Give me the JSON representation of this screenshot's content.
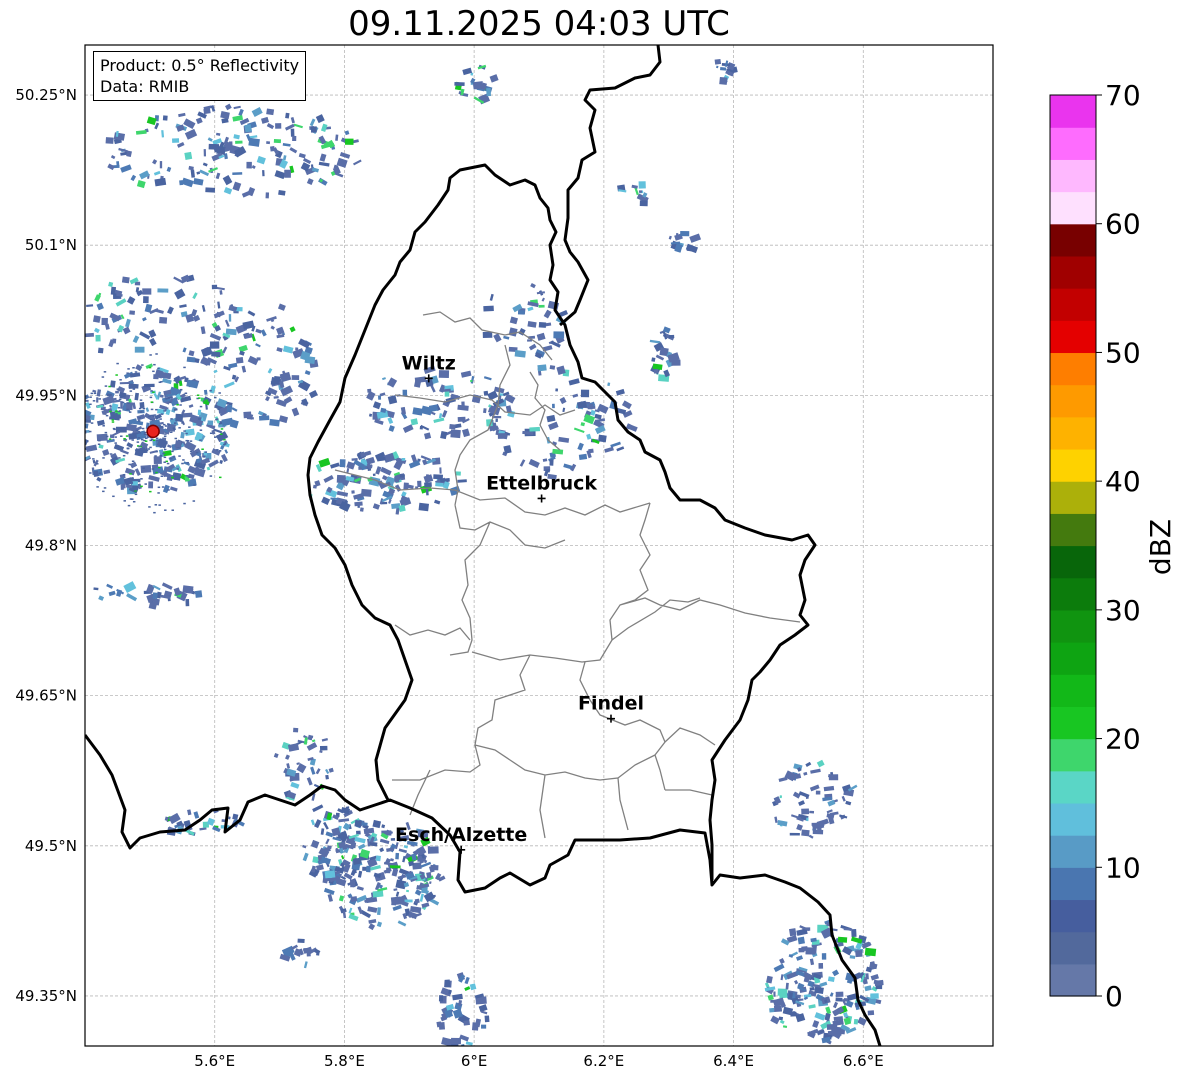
{
  "title": "09.11.2025 04:03 UTC",
  "info_box": {
    "product": "Product: 0.5° Reflectivity",
    "data": "Data: RMIB"
  },
  "map": {
    "lon_range": [
      5.4,
      6.8
    ],
    "lat_range": [
      49.3,
      50.3
    ],
    "lat_ticks": [
      {
        "value": 50.25,
        "label": "50.25°N"
      },
      {
        "value": 50.1,
        "label": "50.1°N"
      },
      {
        "value": 49.95,
        "label": "49.95°N"
      },
      {
        "value": 49.8,
        "label": "49.8°N"
      },
      {
        "value": 49.65,
        "label": "49.65°N"
      },
      {
        "value": 49.5,
        "label": "49.5°N"
      },
      {
        "value": 49.35,
        "label": "49.35°N"
      }
    ],
    "lon_ticks": [
      {
        "value": 5.6,
        "label": "5.6°E"
      },
      {
        "value": 5.8,
        "label": "5.8°E"
      },
      {
        "value": 6.0,
        "label": "6°E"
      },
      {
        "value": 6.2,
        "label": "6.2°E"
      },
      {
        "value": 6.4,
        "label": "6.4°E"
      },
      {
        "value": 6.6,
        "label": "6.6°E"
      }
    ],
    "cities": [
      {
        "name": "Wiltz",
        "lon": 5.93,
        "lat": 49.967
      },
      {
        "name": "Ettelbruck",
        "lon": 6.104,
        "lat": 49.847
      },
      {
        "name": "Findel",
        "lon": 6.211,
        "lat": 49.627
      },
      {
        "name": "Esch/Alzette",
        "lon": 5.98,
        "lat": 49.496
      }
    ],
    "radar_site": {
      "lon": 5.505,
      "lat": 49.914,
      "color": "#e8241e"
    },
    "grid": true
  },
  "colorbar": {
    "label": "dBZ",
    "min": 0,
    "max": 70,
    "step": 2.5,
    "ticks": [
      {
        "value": 0,
        "label": "0"
      },
      {
        "value": 10,
        "label": "10"
      },
      {
        "value": 20,
        "label": "20"
      },
      {
        "value": 30,
        "label": "30"
      },
      {
        "value": 40,
        "label": "40"
      },
      {
        "value": 50,
        "label": "50"
      },
      {
        "value": 60,
        "label": "60"
      },
      {
        "value": 70,
        "label": "70"
      }
    ],
    "colors": [
      "#6578a8",
      "#52699c",
      "#465e9e",
      "#4a76b0",
      "#589bc6",
      "#60bfdc",
      "#5ad6c6",
      "#3ed66c",
      "#18c622",
      "#12b818",
      "#0ea412",
      "#109410",
      "#0c7c0c",
      "#08660a",
      "#447a0e",
      "#acb00a",
      "#fed200",
      "#feb200",
      "#fe9a00",
      "#fe7e00",
      "#e40000",
      "#c20000",
      "#a00000",
      "#780000",
      "#fee0fe",
      "#feb8fe",
      "#fe6cfe",
      "#ea34ee"
    ]
  }
}
